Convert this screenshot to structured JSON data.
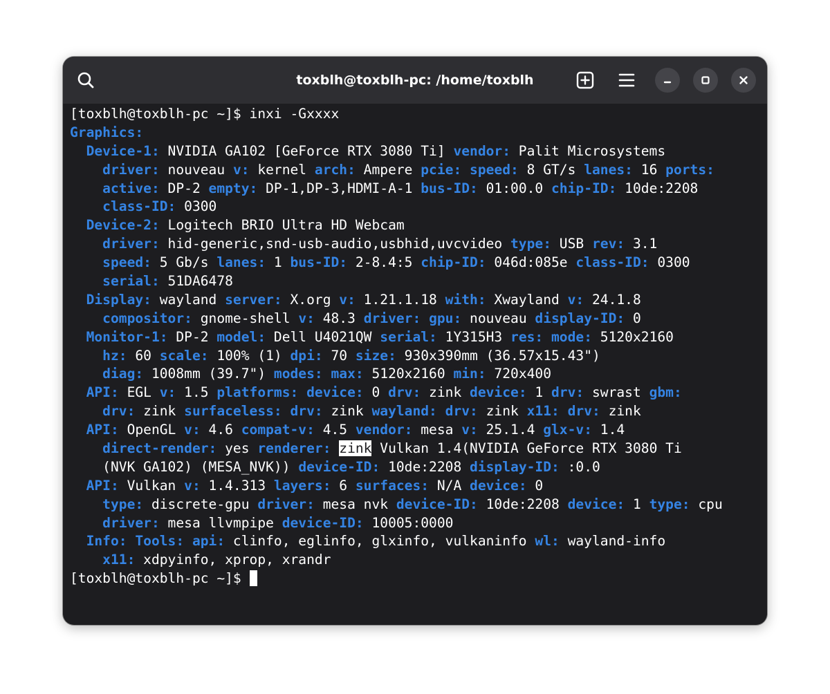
{
  "window": {
    "title": "toxblh@toxblh-pc: /home/toxblh"
  },
  "headerbar": {
    "search_icon": "search-icon",
    "new_tab_icon": "new-tab-icon",
    "menu_icon": "hamburger-menu-icon",
    "minimize_icon": "minimize-icon",
    "maximize_icon": "maximize-icon",
    "close_icon": "close-icon"
  },
  "colors": {
    "key": "#3584e4",
    "text": "#ffffff",
    "background": "#1d1d20",
    "headerbar": "#2e2e32"
  },
  "terminal": {
    "lines": [
      [
        {
          "t": "[toxblh@toxblh-pc ~]$ inxi -Gxxxx",
          "c": "v"
        }
      ],
      [
        {
          "t": "Graphics:",
          "c": "k"
        }
      ],
      [
        {
          "t": "  Device-1:",
          "c": "k"
        },
        {
          "t": " NVIDIA GA102 [GeForce RTX 3080 Ti] ",
          "c": "v"
        },
        {
          "t": "vendor:",
          "c": "k"
        },
        {
          "t": " Palit Microsystems",
          "c": "v"
        }
      ],
      [
        {
          "t": "    driver:",
          "c": "k"
        },
        {
          "t": " nouveau ",
          "c": "v"
        },
        {
          "t": "v:",
          "c": "k"
        },
        {
          "t": " kernel ",
          "c": "v"
        },
        {
          "t": "arch:",
          "c": "k"
        },
        {
          "t": " Ampere ",
          "c": "v"
        },
        {
          "t": "pcie:",
          "c": "k"
        },
        {
          "t": " ",
          "c": "v"
        },
        {
          "t": "speed:",
          "c": "k"
        },
        {
          "t": " 8 GT/s ",
          "c": "v"
        },
        {
          "t": "lanes:",
          "c": "k"
        },
        {
          "t": " 16 ",
          "c": "v"
        },
        {
          "t": "ports:",
          "c": "k"
        }
      ],
      [
        {
          "t": "    active:",
          "c": "k"
        },
        {
          "t": " DP-2 ",
          "c": "v"
        },
        {
          "t": "empty:",
          "c": "k"
        },
        {
          "t": " DP-1,DP-3,HDMI-A-1 ",
          "c": "v"
        },
        {
          "t": "bus-ID:",
          "c": "k"
        },
        {
          "t": " 01:00.0 ",
          "c": "v"
        },
        {
          "t": "chip-ID:",
          "c": "k"
        },
        {
          "t": " 10de:2208",
          "c": "v"
        }
      ],
      [
        {
          "t": "    class-ID:",
          "c": "k"
        },
        {
          "t": " 0300",
          "c": "v"
        }
      ],
      [
        {
          "t": "  Device-2:",
          "c": "k"
        },
        {
          "t": " Logitech BRIO Ultra HD Webcam",
          "c": "v"
        }
      ],
      [
        {
          "t": "    driver:",
          "c": "k"
        },
        {
          "t": " hid-generic,snd-usb-audio,usbhid,uvcvideo ",
          "c": "v"
        },
        {
          "t": "type:",
          "c": "k"
        },
        {
          "t": " USB ",
          "c": "v"
        },
        {
          "t": "rev:",
          "c": "k"
        },
        {
          "t": " 3.1",
          "c": "v"
        }
      ],
      [
        {
          "t": "    speed:",
          "c": "k"
        },
        {
          "t": " 5 Gb/s ",
          "c": "v"
        },
        {
          "t": "lanes:",
          "c": "k"
        },
        {
          "t": " 1 ",
          "c": "v"
        },
        {
          "t": "bus-ID:",
          "c": "k"
        },
        {
          "t": " 2-8.4:5 ",
          "c": "v"
        },
        {
          "t": "chip-ID:",
          "c": "k"
        },
        {
          "t": " 046d:085e ",
          "c": "v"
        },
        {
          "t": "class-ID:",
          "c": "k"
        },
        {
          "t": " 0300",
          "c": "v"
        }
      ],
      [
        {
          "t": "    serial:",
          "c": "k"
        },
        {
          "t": " 51DA6478",
          "c": "v"
        }
      ],
      [
        {
          "t": "  Display:",
          "c": "k"
        },
        {
          "t": " wayland ",
          "c": "v"
        },
        {
          "t": "server:",
          "c": "k"
        },
        {
          "t": " X.org ",
          "c": "v"
        },
        {
          "t": "v:",
          "c": "k"
        },
        {
          "t": " 1.21.1.18 ",
          "c": "v"
        },
        {
          "t": "with:",
          "c": "k"
        },
        {
          "t": " Xwayland ",
          "c": "v"
        },
        {
          "t": "v:",
          "c": "k"
        },
        {
          "t": " 24.1.8",
          "c": "v"
        }
      ],
      [
        {
          "t": "    compositor:",
          "c": "k"
        },
        {
          "t": " gnome-shell ",
          "c": "v"
        },
        {
          "t": "v:",
          "c": "k"
        },
        {
          "t": " 48.3 ",
          "c": "v"
        },
        {
          "t": "driver:",
          "c": "k"
        },
        {
          "t": " ",
          "c": "v"
        },
        {
          "t": "gpu:",
          "c": "k"
        },
        {
          "t": " nouveau ",
          "c": "v"
        },
        {
          "t": "display-ID:",
          "c": "k"
        },
        {
          "t": " 0",
          "c": "v"
        }
      ],
      [
        {
          "t": "  Monitor-1:",
          "c": "k"
        },
        {
          "t": " DP-2 ",
          "c": "v"
        },
        {
          "t": "model:",
          "c": "k"
        },
        {
          "t": " Dell U4021QW ",
          "c": "v"
        },
        {
          "t": "serial:",
          "c": "k"
        },
        {
          "t": " 1Y315H3 ",
          "c": "v"
        },
        {
          "t": "res:",
          "c": "k"
        },
        {
          "t": " ",
          "c": "v"
        },
        {
          "t": "mode:",
          "c": "k"
        },
        {
          "t": " 5120x2160",
          "c": "v"
        }
      ],
      [
        {
          "t": "    hz:",
          "c": "k"
        },
        {
          "t": " 60 ",
          "c": "v"
        },
        {
          "t": "scale:",
          "c": "k"
        },
        {
          "t": " 100% (1) ",
          "c": "v"
        },
        {
          "t": "dpi:",
          "c": "k"
        },
        {
          "t": " 70 ",
          "c": "v"
        },
        {
          "t": "size:",
          "c": "k"
        },
        {
          "t": " 930x390mm (36.57x15.43\")",
          "c": "v"
        }
      ],
      [
        {
          "t": "    diag:",
          "c": "k"
        },
        {
          "t": " 1008mm (39.7\") ",
          "c": "v"
        },
        {
          "t": "modes:",
          "c": "k"
        },
        {
          "t": " ",
          "c": "v"
        },
        {
          "t": "max:",
          "c": "k"
        },
        {
          "t": " 5120x2160 ",
          "c": "v"
        },
        {
          "t": "min:",
          "c": "k"
        },
        {
          "t": " 720x400",
          "c": "v"
        }
      ],
      [
        {
          "t": "  API:",
          "c": "k"
        },
        {
          "t": " EGL ",
          "c": "v"
        },
        {
          "t": "v:",
          "c": "k"
        },
        {
          "t": " 1.5 ",
          "c": "v"
        },
        {
          "t": "platforms:",
          "c": "k"
        },
        {
          "t": " ",
          "c": "v"
        },
        {
          "t": "device:",
          "c": "k"
        },
        {
          "t": " 0 ",
          "c": "v"
        },
        {
          "t": "drv:",
          "c": "k"
        },
        {
          "t": " zink ",
          "c": "v"
        },
        {
          "t": "device:",
          "c": "k"
        },
        {
          "t": " 1 ",
          "c": "v"
        },
        {
          "t": "drv:",
          "c": "k"
        },
        {
          "t": " swrast ",
          "c": "v"
        },
        {
          "t": "gbm:",
          "c": "k"
        }
      ],
      [
        {
          "t": "    drv:",
          "c": "k"
        },
        {
          "t": " zink ",
          "c": "v"
        },
        {
          "t": "surfaceless:",
          "c": "k"
        },
        {
          "t": " ",
          "c": "v"
        },
        {
          "t": "drv:",
          "c": "k"
        },
        {
          "t": " zink ",
          "c": "v"
        },
        {
          "t": "wayland:",
          "c": "k"
        },
        {
          "t": " ",
          "c": "v"
        },
        {
          "t": "drv:",
          "c": "k"
        },
        {
          "t": " zink ",
          "c": "v"
        },
        {
          "t": "x11:",
          "c": "k"
        },
        {
          "t": " ",
          "c": "v"
        },
        {
          "t": "drv:",
          "c": "k"
        },
        {
          "t": " zink",
          "c": "v"
        }
      ],
      [
        {
          "t": "  API:",
          "c": "k"
        },
        {
          "t": " OpenGL ",
          "c": "v"
        },
        {
          "t": "v:",
          "c": "k"
        },
        {
          "t": " 4.6 ",
          "c": "v"
        },
        {
          "t": "compat-v:",
          "c": "k"
        },
        {
          "t": " 4.5 ",
          "c": "v"
        },
        {
          "t": "vendor:",
          "c": "k"
        },
        {
          "t": " mesa ",
          "c": "v"
        },
        {
          "t": "v:",
          "c": "k"
        },
        {
          "t": " 25.1.4 ",
          "c": "v"
        },
        {
          "t": "glx-v:",
          "c": "k"
        },
        {
          "t": " 1.4",
          "c": "v"
        }
      ],
      [
        {
          "t": "    direct-render:",
          "c": "k"
        },
        {
          "t": " yes ",
          "c": "v"
        },
        {
          "t": "renderer:",
          "c": "k"
        },
        {
          "t": " ",
          "c": "v"
        },
        {
          "t": "zink",
          "c": "hl"
        },
        {
          "t": " Vulkan 1.4(NVIDIA GeForce RTX 3080 Ti",
          "c": "v"
        }
      ],
      [
        {
          "t": "    (NVK GA102) (MESA_NVK)) ",
          "c": "v"
        },
        {
          "t": "device-ID:",
          "c": "k"
        },
        {
          "t": " 10de:2208 ",
          "c": "v"
        },
        {
          "t": "display-ID:",
          "c": "k"
        },
        {
          "t": " :0.0",
          "c": "v"
        }
      ],
      [
        {
          "t": "  API:",
          "c": "k"
        },
        {
          "t": " Vulkan ",
          "c": "v"
        },
        {
          "t": "v:",
          "c": "k"
        },
        {
          "t": " 1.4.313 ",
          "c": "v"
        },
        {
          "t": "layers:",
          "c": "k"
        },
        {
          "t": " 6 ",
          "c": "v"
        },
        {
          "t": "surfaces:",
          "c": "k"
        },
        {
          "t": " N/A ",
          "c": "v"
        },
        {
          "t": "device:",
          "c": "k"
        },
        {
          "t": " 0",
          "c": "v"
        }
      ],
      [
        {
          "t": "    type:",
          "c": "k"
        },
        {
          "t": " discrete-gpu ",
          "c": "v"
        },
        {
          "t": "driver:",
          "c": "k"
        },
        {
          "t": " mesa nvk ",
          "c": "v"
        },
        {
          "t": "device-ID:",
          "c": "k"
        },
        {
          "t": " 10de:2208 ",
          "c": "v"
        },
        {
          "t": "device:",
          "c": "k"
        },
        {
          "t": " 1 ",
          "c": "v"
        },
        {
          "t": "type:",
          "c": "k"
        },
        {
          "t": " cpu",
          "c": "v"
        }
      ],
      [
        {
          "t": "    driver:",
          "c": "k"
        },
        {
          "t": " mesa llvmpipe ",
          "c": "v"
        },
        {
          "t": "device-ID:",
          "c": "k"
        },
        {
          "t": " 10005:0000",
          "c": "v"
        }
      ],
      [
        {
          "t": "  Info:",
          "c": "k"
        },
        {
          "t": " ",
          "c": "v"
        },
        {
          "t": "Tools:",
          "c": "k"
        },
        {
          "t": " ",
          "c": "v"
        },
        {
          "t": "api:",
          "c": "k"
        },
        {
          "t": " clinfo, eglinfo, glxinfo, vulkaninfo ",
          "c": "v"
        },
        {
          "t": "wl:",
          "c": "k"
        },
        {
          "t": " wayland-info",
          "c": "v"
        }
      ],
      [
        {
          "t": "    x11:",
          "c": "k"
        },
        {
          "t": " xdpyinfo, xprop, xrandr",
          "c": "v"
        }
      ],
      [
        {
          "t": "[toxblh@toxblh-pc ~]$ ",
          "c": "v"
        },
        {
          "t": "",
          "c": "cursor"
        }
      ]
    ]
  }
}
